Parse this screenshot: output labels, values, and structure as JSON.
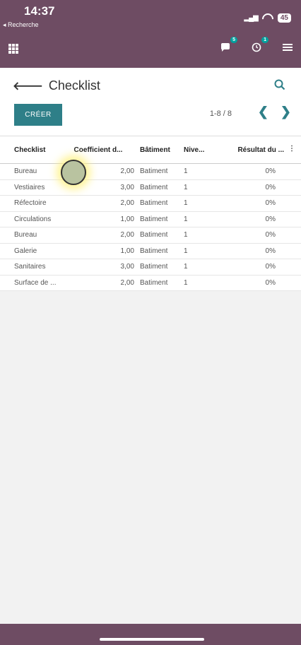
{
  "status": {
    "time": "14:37",
    "back_label": "◂ Recherche",
    "battery": "45"
  },
  "nav": {
    "messages_count": "5",
    "activity_count": "1"
  },
  "control": {
    "title": "Checklist",
    "create_label": "CRÉER",
    "pager": "1-8 / 8"
  },
  "table": {
    "headers": [
      "Checklist",
      "Coefficient d...",
      "Bâtiment",
      "Nive...",
      "Résultat du ..."
    ],
    "rows": [
      [
        "Bureau",
        "2,00",
        "Batiment",
        "1",
        "0%"
      ],
      [
        "Vestiaires",
        "3,00",
        "Batiment",
        "1",
        "0%"
      ],
      [
        "Réfectoire",
        "2,00",
        "Batiment",
        "1",
        "0%"
      ],
      [
        "Circulations",
        "1,00",
        "Batiment",
        "1",
        "0%"
      ],
      [
        "Bureau",
        "2,00",
        "Batiment",
        "1",
        "0%"
      ],
      [
        "Galerie",
        "1,00",
        "Batiment",
        "1",
        "0%"
      ],
      [
        "Sanitaires",
        "3,00",
        "Batiment",
        "1",
        "0%"
      ],
      [
        "Surface de ...",
        "2,00",
        "Batiment",
        "1",
        "0%"
      ]
    ]
  },
  "colors": {
    "topbar": "#6e4c63",
    "accent": "#2e7f88",
    "badge": "#00a09d"
  },
  "icons": {
    "apps": "apps-grid-icon",
    "messages": "chat-icon",
    "activity": "clock-icon",
    "menu": "hamburger-icon",
    "search": "search-icon"
  }
}
